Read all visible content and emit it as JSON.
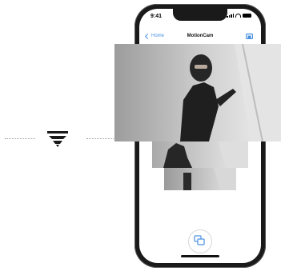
{
  "status_bar": {
    "time": "9:41"
  },
  "nav": {
    "back_label": "Home",
    "title": "MotionCam"
  },
  "icons": {
    "brand_logo": "brand-logo-icon",
    "back": "chevron-left-icon",
    "nav_action": "camera-icon",
    "gallery": "gallery-icon"
  },
  "colors": {
    "accent": "#4a90e2",
    "phone_frame": "#1a1a1a"
  },
  "photos": [
    {
      "description_name": "motion-photo-main"
    },
    {
      "description_name": "motion-photo-previous"
    },
    {
      "description_name": "motion-photo-older"
    }
  ]
}
